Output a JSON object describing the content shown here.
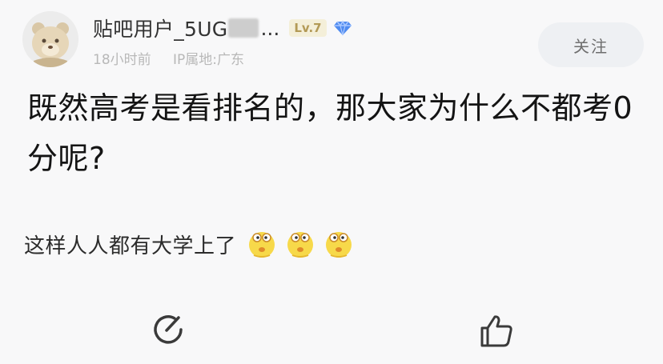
{
  "post_header": {
    "username_visible": "贴吧用户_5UG",
    "username_ellipsis": "...",
    "level_badge": "Lv.7",
    "badge_icon": "diamond-icon",
    "time_ago": "18小时前",
    "ip_location": "IP属地:广东",
    "follow_label": "关注"
  },
  "post": {
    "title": "既然高考是看排名的，那大家为什么不都考0分呢?",
    "body": "这样人人都有大学上了",
    "emojis": [
      "emoji-icon",
      "emoji-icon",
      "emoji-icon"
    ]
  },
  "actions": {
    "comment_icon": "comment-icon",
    "like_icon": "thumbs-up-icon"
  },
  "colors": {
    "background": "#f8f8f9",
    "follow_bg": "#eef0f3",
    "badge_bg": "#f4efd9",
    "badge_text": "#b39a56",
    "diamond": "#4f8bf0"
  }
}
